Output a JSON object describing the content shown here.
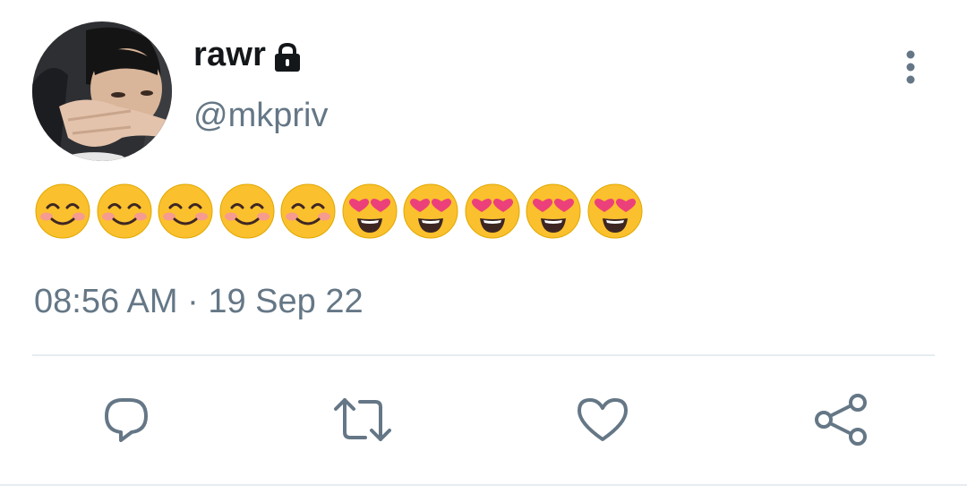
{
  "tweet": {
    "display_name": "rawr",
    "handle": "@mkpriv",
    "is_protected": true,
    "text": "😊😊😊😊😊😍😍😍😍😍",
    "emojis": [
      "smiling-face",
      "smiling-face",
      "smiling-face",
      "smiling-face",
      "smiling-face",
      "heart-eyes",
      "heart-eyes",
      "heart-eyes",
      "heart-eyes",
      "heart-eyes"
    ],
    "time": "08:56 AM",
    "separator": " · ",
    "date": "19 Sep 22"
  },
  "icons": {
    "lock": "lock-icon",
    "more": "more-vertical-icon",
    "reply": "reply-icon",
    "retweet": "retweet-icon",
    "like": "heart-icon",
    "share": "share-icon"
  },
  "colors": {
    "name": "#14171a",
    "secondary": "#657786",
    "divider": "#e6ecf0",
    "emoji_yellow": "#fbc02d",
    "heart_pink": "#ec407a"
  }
}
